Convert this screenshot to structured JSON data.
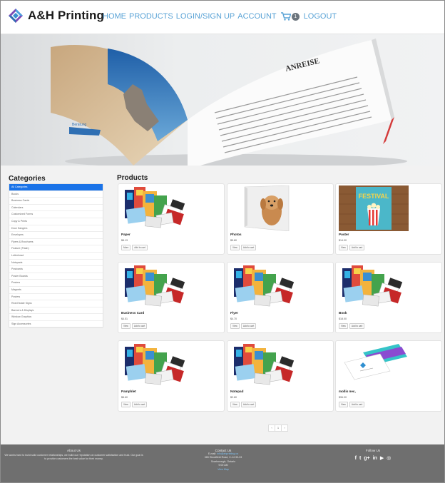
{
  "nav": {
    "brand": "A&H Printing",
    "links": {
      "home": "HOME",
      "products": "PRODUCTS",
      "login": "LOGIN/SIGN UP",
      "account": "ACCOUNT",
      "cart_count": "1",
      "logout": "LOGOUT"
    }
  },
  "hero": {
    "book_heading": "ANREISE",
    "brochure_label": "Beratung"
  },
  "categories": {
    "title": "Categories",
    "items": [
      "All Categories",
      "Books",
      "Business Cards",
      "Calendars",
      "Customized Forms",
      "Copy & Prints",
      "Door Hangers",
      "Envelopes",
      "Flyers & Brochures",
      "Feature (Flash)",
      "Letterhead",
      "Notepads",
      "Postcards",
      "Poster Boards",
      "Posters",
      "Magnets",
      "Posters",
      "Real Estate Signs",
      "Banners & Displays",
      "Window Graphics",
      "Sign Accessories"
    ]
  },
  "products": {
    "title": "Products",
    "items": [
      {
        "name": "Paper",
        "price": "$8.13",
        "btn1": "More",
        "btn2": "Add to cart",
        "image": "print-collage"
      },
      {
        "name": "Photos",
        "price": "$5.80",
        "btn1": "View",
        "btn2": "Add to cart",
        "image": "dog-canvas"
      },
      {
        "name": "Poster",
        "price": "$14.00",
        "btn1": "View",
        "btn2": "Add to cart",
        "image": "festival-poster"
      },
      {
        "name": "Business Card",
        "price": "$4.51",
        "btn1": "View",
        "btn2": "Add to cart",
        "image": "print-collage"
      },
      {
        "name": "Flyer",
        "price": "$4.70",
        "btn1": "View",
        "btn2": "Add to cart",
        "image": "print-collage"
      },
      {
        "name": "Book",
        "price": "$18.00",
        "btn1": "View",
        "btn2": "Add to cart",
        "image": "print-collage"
      },
      {
        "name": "Pamphlet",
        "price": "$8.60",
        "btn1": "View",
        "btn2": "Add to cart",
        "image": "print-collage"
      },
      {
        "name": "Notepad",
        "price": "$2.80",
        "btn1": "View",
        "btn2": "Add to cart",
        "image": "print-collage"
      },
      {
        "name": "mollis nec,",
        "price": "$96.00",
        "btn1": "View",
        "btn2": "Add to cart",
        "image": "business-cards"
      }
    ],
    "festival_text": "FESTIVAL"
  },
  "pagination": {
    "prev": "‹",
    "current": "1",
    "next": "›"
  },
  "footer": {
    "about": {
      "title": "About Us",
      "text": "We works hard to build solid customer relationships, we build our reputation on customer satisfaction and trust. Our goal is to provide customers the best value for their money."
    },
    "contact": {
      "title": "Contact Us",
      "email_prefix": "E-mail:",
      "email": "info@ahprinting.ca",
      "address": "385 Woodfield Road, C-14 33-33",
      "city": "Scarborough, Ontario",
      "hours": "9:00 AM",
      "map_link": "View Map"
    },
    "follow": {
      "title": "Follow Us",
      "icons": [
        "facebook-icon",
        "twitter-icon",
        "google-plus-icon",
        "linkedin-icon",
        "youtube-icon",
        "instagram-icon"
      ]
    }
  },
  "colors": {
    "link": "#5aa3d6",
    "active": "#1a73e8",
    "footer": "#6f6f6f"
  }
}
